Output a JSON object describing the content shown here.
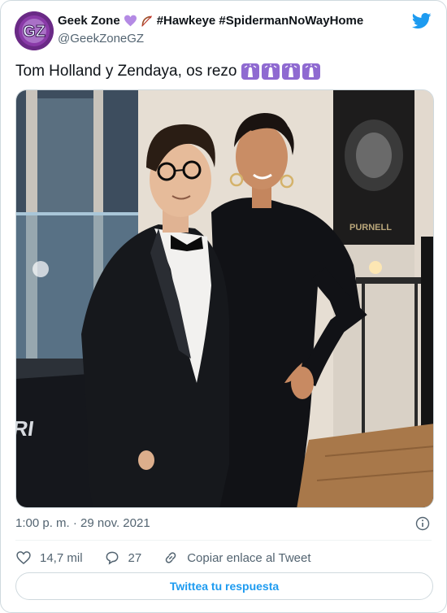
{
  "tweet": {
    "author_name": "Geek Zone",
    "author_tags": "#Hawkeye #SpidermanNoWayHome",
    "handle": "@GeekZoneGZ",
    "avatar_text": "GZ",
    "text": "Tom Holland y Zendaya, os rezo",
    "emoji_count": 4,
    "timestamp": "1:00 p. m. · 29 nov. 2021",
    "likes": "14,7 mil",
    "replies": "27",
    "copy_link_label": "Copiar enlace al Tweet",
    "reply_button_label": "Twittea tu respuesta",
    "photo_signage": "PURI",
    "photo_poster_text": "PURNELL"
  },
  "icons": {
    "emoji_in_name": [
      "purple-heart-icon",
      "bow-and-arrow-icon"
    ],
    "emoji_in_text": "folded-hands-icon",
    "brand": "twitter-bird-icon",
    "info": "info-icon",
    "like": "heart-outline-icon",
    "reply": "reply-bubble-icon",
    "copy": "link-icon"
  },
  "colors": {
    "brand_blue": "#1d9bf0",
    "secondary_text": "#536471",
    "border": "#cfd9de",
    "emoji_purple": "#8f6ad1"
  }
}
